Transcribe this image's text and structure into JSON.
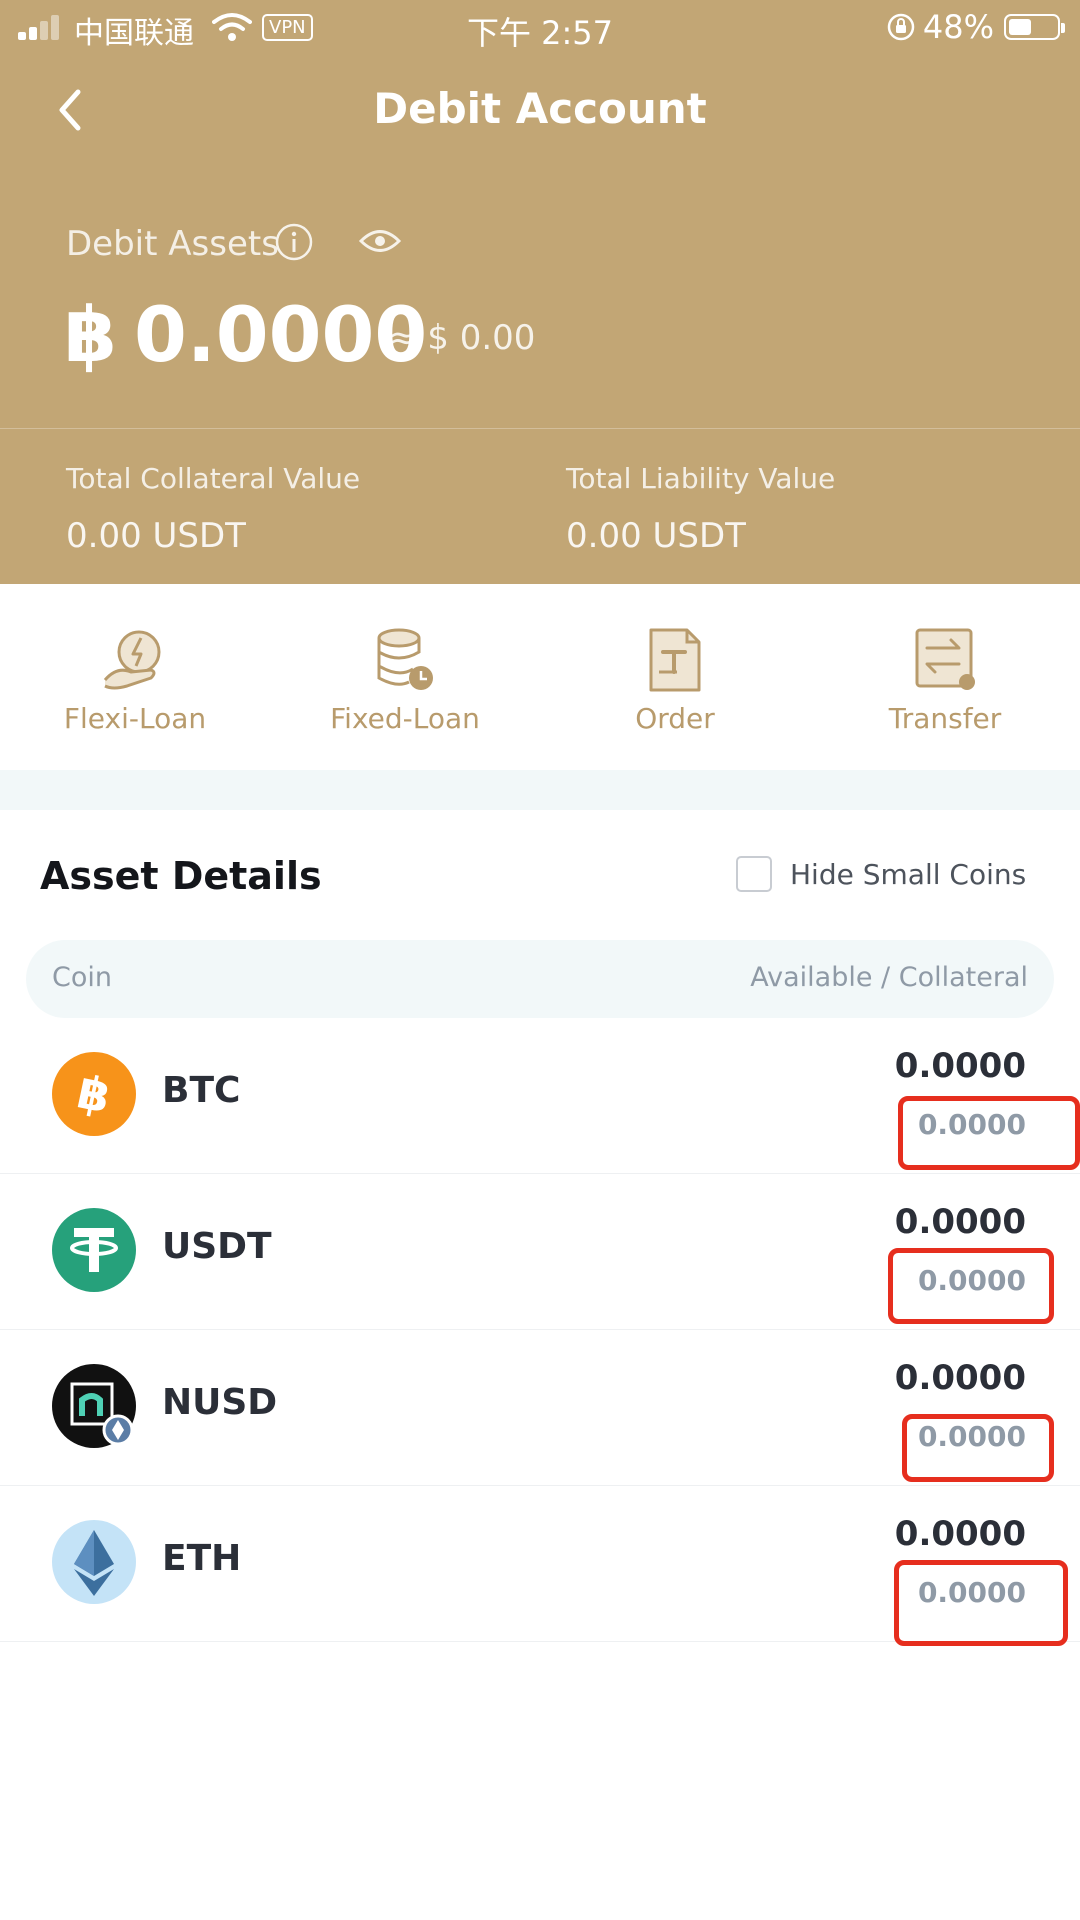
{
  "status_bar": {
    "carrier": "中国联通",
    "vpn": "VPN",
    "time": "下午 2:57",
    "battery": "48%",
    "battery_level": 0.48
  },
  "header": {
    "title": "Debit Account",
    "assets_label": "Debit Assets",
    "currency_symbol": "฿",
    "balance": "0.0000",
    "approx": "≈ $ 0.00",
    "total_collateral_label": "Total Collateral Value",
    "total_collateral_value": "0.00 USDT",
    "total_liability_label": "Total Liability Value",
    "total_liability_value": "0.00 USDT"
  },
  "actions": [
    {
      "label": "Flexi-Loan",
      "icon": "flexi-loan-icon"
    },
    {
      "label": "Fixed-Loan",
      "icon": "fixed-loan-icon"
    },
    {
      "label": "Order",
      "icon": "order-icon"
    },
    {
      "label": "Transfer",
      "icon": "transfer-icon"
    }
  ],
  "asset_details": {
    "title": "Asset Details",
    "hide_small_label": "Hide Small Coins",
    "hide_small_checked": false,
    "col_coin": "Coin",
    "col_available": "Available / Collateral",
    "rows": [
      {
        "coin": "BTC",
        "available": "0.0000",
        "collateral": "0.0000",
        "icon_color": "#f7931a"
      },
      {
        "coin": "USDT",
        "available": "0.0000",
        "collateral": "0.0000",
        "icon_color": "#26a17b"
      },
      {
        "coin": "NUSD",
        "available": "0.0000",
        "collateral": "0.0000",
        "icon_color": "#111111"
      },
      {
        "coin": "ETH",
        "available": "0.0000",
        "collateral": "0.0000",
        "icon_color": "#c4e3f7"
      }
    ]
  },
  "colors": {
    "header_bg": "#c2a675",
    "action_label": "#b89b6c",
    "highlight": "#e62e1e"
  }
}
